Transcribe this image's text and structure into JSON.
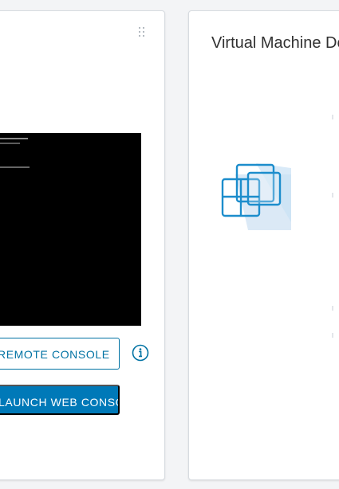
{
  "console_panel": {
    "remote_console_label": "REMOTE CONSOLE",
    "launch_console_label": "LAUNCH WEB CONSOLE",
    "info_icon": "info-icon",
    "drag_icon": "drag-handle-icon"
  },
  "vm_panel": {
    "title": "Virtual Machine Details",
    "icon": "virtual-machine-icon"
  },
  "colors": {
    "primary": "#0079b8",
    "primary_outline": "#0072a3",
    "card_border": "#d7dbe0",
    "console_bg": "#000000"
  }
}
